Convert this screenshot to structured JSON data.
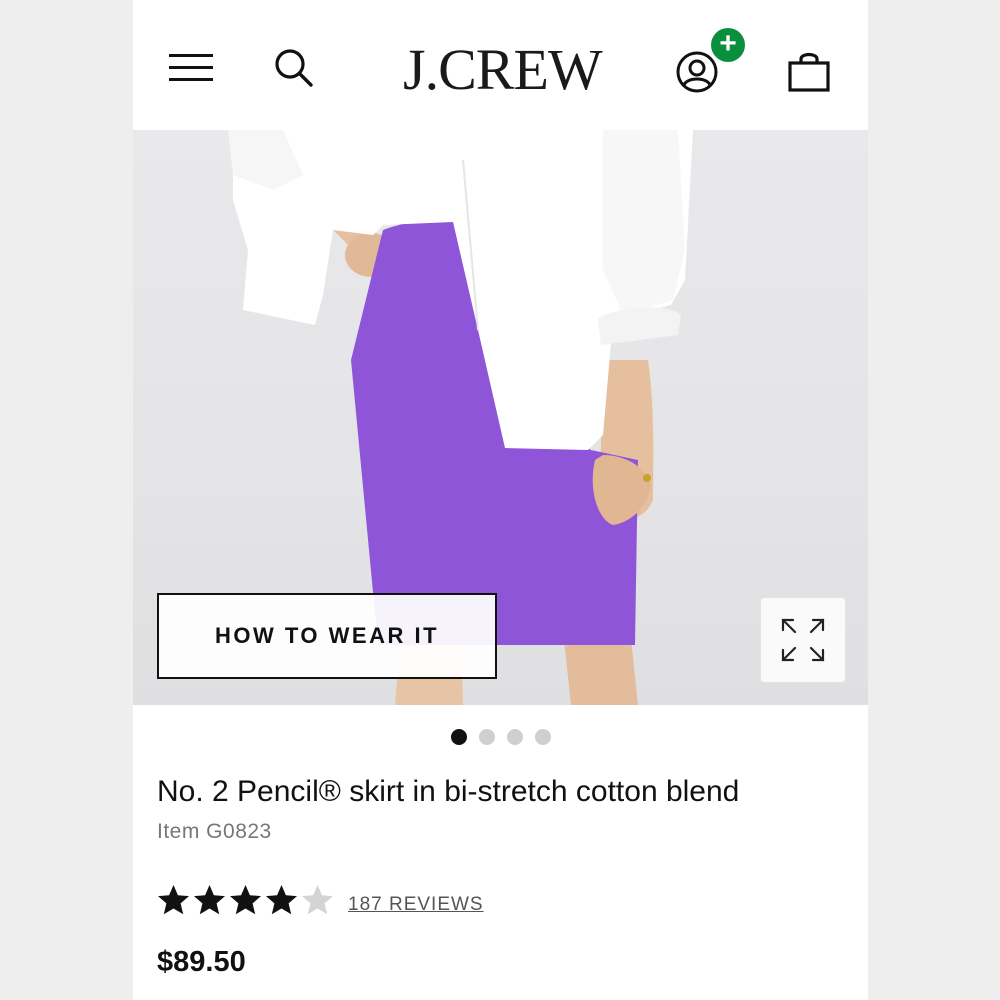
{
  "header": {
    "logo": "J.CREW",
    "badge": "+",
    "icons": [
      "menu-icon",
      "search-icon",
      "account-icon",
      "shopping-bag-icon"
    ]
  },
  "hero": {
    "how_to_wear_label": "HOW TO WEAR IT",
    "expand_icon": "expand-icon",
    "skirt_color": "#8f55d9"
  },
  "carousel": {
    "total": 4,
    "active": 1
  },
  "product": {
    "title": "No. 2 Pencil® skirt in bi-stretch cotton blend",
    "item_number": "Item G0823",
    "rating": 4,
    "rating_max": 5,
    "reviews_label": "187 REVIEWS",
    "price": "$89.50"
  },
  "colors": {
    "badge_green": "#0a8f3c",
    "text": "#111111"
  }
}
